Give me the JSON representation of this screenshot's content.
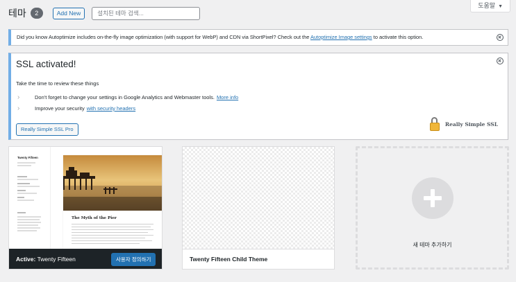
{
  "help": {
    "label": "도움말",
    "caret": "▼"
  },
  "header": {
    "title": "테마",
    "count": "2",
    "add_new": "Add New",
    "search_placeholder": "설치된 테마 검색..."
  },
  "autoptimize_notice": {
    "text_before": "Did you know Autoptimize includes on-the-fly image optimization (with support for WebP) and CDN via ShortPixel? Check out the ",
    "link": "Autoptimize Image settings",
    "text_after": " to activate this option."
  },
  "ssl_notice": {
    "title": "SSL activated!",
    "subtitle": "Take the time to review these things",
    "items": [
      {
        "text": "Don't forget to change your settings in Google Analytics and Webmaster tools.",
        "link": "More info"
      },
      {
        "text": "Improve your security",
        "link": "with security headers"
      }
    ],
    "button": "Really Simple SSL Pro",
    "logo_text": "Really Simple SSL"
  },
  "themes": {
    "active": {
      "label_prefix": "Active:",
      "name": "Twenty Fifteen",
      "customize": "사용자 정의하기",
      "screenshot": {
        "site_title": "Twenty Fifteen",
        "post_title": "The Myth of the Pier"
      }
    },
    "child": {
      "name": "Twenty Fifteen Child Theme"
    },
    "add_new": {
      "label": "새 테마 추가하기"
    }
  },
  "colors": {
    "accent": "#2271b1",
    "notice_border": "#72aee6",
    "active_bar": "#1d2327"
  }
}
